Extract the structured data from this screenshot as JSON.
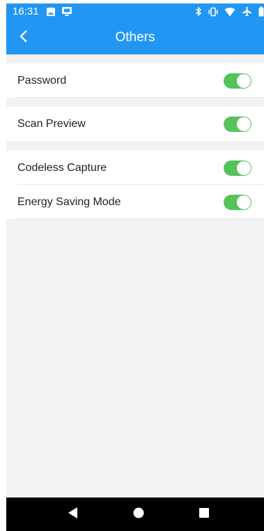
{
  "status_bar": {
    "time": "16:31",
    "left_icons": [
      "image-icon",
      "screen-cast-icon"
    ],
    "right_icons": [
      "bluetooth-icon",
      "vibrate-icon",
      "wifi-icon",
      "airplane-icon",
      "battery-icon"
    ]
  },
  "app_bar": {
    "title": "Others",
    "back_icon": "chevron-left-icon"
  },
  "settings": [
    {
      "label": "Password",
      "enabled": true
    },
    {
      "label": "Scan Preview",
      "enabled": true
    },
    {
      "label": "Codeless Capture",
      "enabled": true
    },
    {
      "label": "Energy Saving Mode",
      "enabled": true
    }
  ],
  "nav_bar": {
    "buttons": [
      "back-triangle-icon",
      "home-circle-icon",
      "recents-square-icon"
    ]
  },
  "colors": {
    "accent": "#2196f3",
    "toggle_on": "#55c35a",
    "background": "#f2f2f2",
    "nav_bar": "#000000"
  }
}
